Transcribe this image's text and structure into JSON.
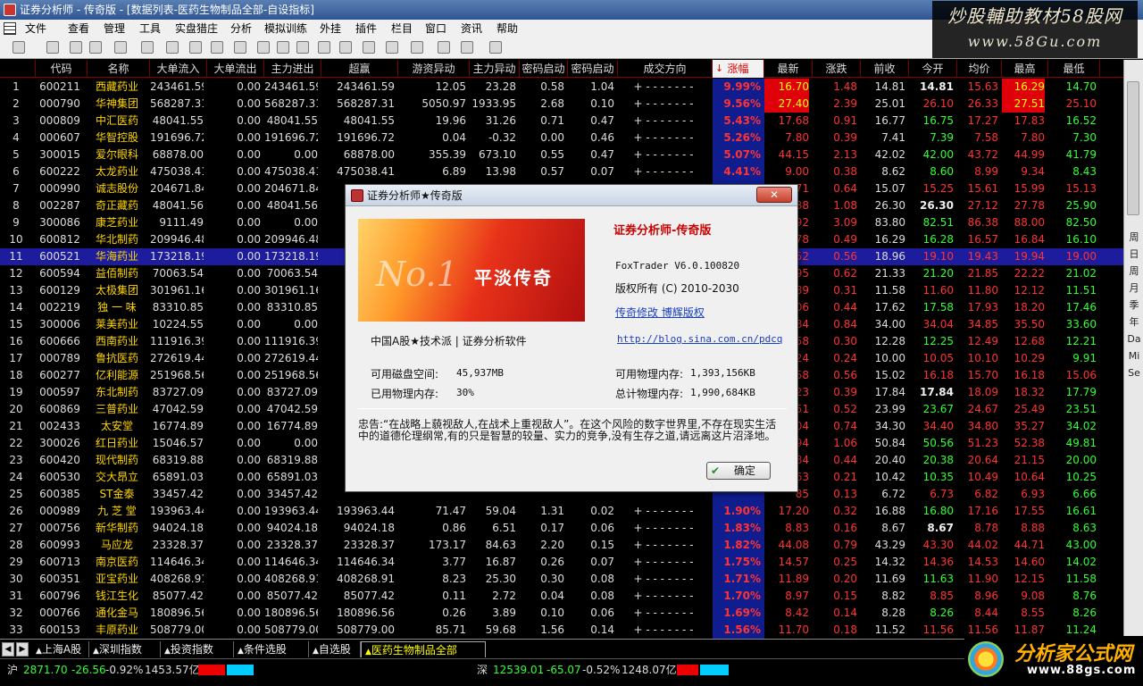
{
  "window": {
    "title": "证券分析师 - 传奇版 - [数据列表-医药生物制品全部-自设指标]"
  },
  "watermark": {
    "line1": "炒股輔助教材58股网",
    "line2": "www.58Gu.com"
  },
  "menu": [
    "文件",
    "查看",
    "管理",
    "工具",
    "实盘猎庄",
    "分析",
    "模拟训练",
    "外挂",
    "插件",
    "栏目",
    "窗口",
    "资讯",
    "帮助"
  ],
  "toolbar": {
    "icons": [
      "open-icon",
      "chart-icon",
      "crosshair-icon",
      "pen-icon",
      "power-icon",
      "compare-icon",
      "layout-icon",
      "stop-icon",
      "color-icon",
      "zoom-icon",
      "home-icon",
      "filter-icon",
      "grid-icon",
      "candle-icon",
      "candle-icon-2",
      "trend-icon",
      "cursor-icon",
      "line-icon",
      "text-icon",
      "eraser-icon",
      "save-icon"
    ]
  },
  "columns": [
    "",
    "代码",
    "名称",
    "大单流入",
    "大单流出",
    "主力进出",
    "超赢",
    "游资异动",
    "主力异动",
    "密码启动",
    "密码启动",
    "成交方向",
    "涨幅",
    "最新",
    "涨跌",
    "前收",
    "今开",
    "均价",
    "最高",
    "最低"
  ],
  "sort_indicator": "↓",
  "rows": [
    {
      "n": "1",
      "code": "600211",
      "name": "西藏药业",
      "in": "243461.59",
      "out": "0.00",
      "net": "243461.59",
      "super": "243461.59",
      "hot": "12.05",
      "main": "23.28",
      "p1": "0.58",
      "p2": "1.04",
      "dir": "+ - - - - - - -",
      "pct": "9.99%",
      "last": "16.70",
      "chg": "1.48",
      "prev": "14.81",
      "open": "14.81",
      "avg": "15.63",
      "high": "16.29",
      "low": "14.70",
      "hl": true
    },
    {
      "n": "2",
      "code": "000790",
      "name": "华神集团",
      "in": "568287.31",
      "out": "0.00",
      "net": "568287.31",
      "super": "568287.31",
      "hot": "5050.97",
      "main": "1933.95",
      "p1": "2.68",
      "p2": "0.10",
      "dir": "+ - - - - - - -",
      "pct": "9.56%",
      "last": "27.40",
      "chg": "2.39",
      "prev": "25.01",
      "open": "26.10",
      "avg": "26.33",
      "high": "27.51",
      "low": "25.10",
      "hl": true
    },
    {
      "n": "3",
      "code": "000809",
      "name": "中汇医药",
      "in": "48041.55",
      "out": "0.00",
      "net": "48041.55",
      "super": "48041.55",
      "hot": "19.96",
      "main": "31.26",
      "p1": "0.71",
      "p2": "0.47",
      "dir": "+ - - - - - - -",
      "pct": "5.43%",
      "last": "17.68",
      "chg": "0.91",
      "prev": "16.77",
      "open": "16.75",
      "avg": "17.27",
      "high": "17.83",
      "low": "16.52"
    },
    {
      "n": "4",
      "code": "000607",
      "name": "华智控股",
      "in": "191696.72",
      "out": "0.00",
      "net": "191696.72",
      "super": "191696.72",
      "hot": "0.04",
      "main": "-0.32",
      "p1": "0.00",
      "p2": "0.46",
      "dir": "+ - - - - - - -",
      "pct": "5.26%",
      "last": "7.80",
      "chg": "0.39",
      "prev": "7.41",
      "open": "7.39",
      "avg": "7.58",
      "high": "7.80",
      "low": "7.30"
    },
    {
      "n": "5",
      "code": "300015",
      "name": "爱尔眼科",
      "in": "68878.00",
      "out": "0.00",
      "net": "0.00",
      "super": "68878.00",
      "hot": "355.39",
      "main": "673.10",
      "p1": "0.55",
      "p2": "0.47",
      "dir": "+ - - - - - - -",
      "pct": "5.07%",
      "last": "44.15",
      "chg": "2.13",
      "prev": "42.02",
      "open": "42.00",
      "avg": "43.72",
      "high": "44.99",
      "low": "41.79"
    },
    {
      "n": "6",
      "code": "600222",
      "name": "太龙药业",
      "in": "475038.41",
      "out": "0.00",
      "net": "475038.41",
      "super": "475038.41",
      "hot": "6.89",
      "main": "13.98",
      "p1": "0.57",
      "p2": "0.07",
      "dir": "+ - - - - - - -",
      "pct": "4.41%",
      "last": "9.00",
      "chg": "0.38",
      "prev": "8.62",
      "open": "8.60",
      "avg": "8.99",
      "high": "9.34",
      "low": "8.43"
    },
    {
      "n": "7",
      "code": "000990",
      "name": "诚志股份",
      "in": "204671.84",
      "out": "0.00",
      "net": "204671.84",
      "super": "",
      "hot": "",
      "main": "",
      "p1": "",
      "p2": "",
      "dir": "",
      "pct": "",
      "last": "71",
      "chg": "0.64",
      "prev": "15.07",
      "open": "15.25",
      "avg": "15.61",
      "high": "15.99",
      "low": "15.13"
    },
    {
      "n": "8",
      "code": "002287",
      "name": "奇正藏药",
      "in": "48041.56",
      "out": "0.00",
      "net": "48041.56",
      "super": "",
      "hot": "",
      "main": "",
      "p1": "",
      "p2": "",
      "dir": "",
      "pct": "",
      "last": "38",
      "chg": "1.08",
      "prev": "26.30",
      "open": "26.30",
      "avg": "27.12",
      "high": "27.78",
      "low": "25.90"
    },
    {
      "n": "9",
      "code": "300086",
      "name": "康芝药业",
      "in": "9111.49",
      "out": "0.00",
      "net": "0.00",
      "super": "",
      "hot": "",
      "main": "",
      "p1": "",
      "p2": "",
      "dir": "",
      "pct": "",
      "last": "92",
      "chg": "3.09",
      "prev": "83.80",
      "open": "82.51",
      "avg": "86.38",
      "high": "88.00",
      "low": "82.50"
    },
    {
      "n": "10",
      "code": "600812",
      "name": "华北制药",
      "in": "209946.48",
      "out": "0.00",
      "net": "209946.48",
      "super": "",
      "hot": "",
      "main": "",
      "p1": "",
      "p2": "",
      "dir": "",
      "pct": "",
      "last": "78",
      "chg": "0.49",
      "prev": "16.29",
      "open": "16.28",
      "avg": "16.57",
      "high": "16.84",
      "low": "16.10"
    },
    {
      "n": "11",
      "code": "600521",
      "name": "华海药业",
      "in": "173218.19",
      "out": "0.00",
      "net": "173218.19",
      "super": "",
      "hot": "",
      "main": "",
      "p1": "",
      "p2": "",
      "dir": "",
      "pct": "",
      "last": "52",
      "chg": "0.56",
      "prev": "18.96",
      "open": "19.10",
      "avg": "19.43",
      "high": "19.94",
      "low": "19.00",
      "sel": true
    },
    {
      "n": "12",
      "code": "600594",
      "name": "益佰制药",
      "in": "70063.54",
      "out": "0.00",
      "net": "70063.54",
      "super": "",
      "hot": "",
      "main": "",
      "p1": "",
      "p2": "",
      "dir": "",
      "pct": "",
      "last": "95",
      "chg": "0.62",
      "prev": "21.33",
      "open": "21.20",
      "avg": "21.85",
      "high": "22.22",
      "low": "21.02"
    },
    {
      "n": "13",
      "code": "600129",
      "name": "太极集团",
      "in": "301961.16",
      "out": "0.00",
      "net": "301961.16",
      "super": "",
      "hot": "",
      "main": "",
      "p1": "",
      "p2": "",
      "dir": "",
      "pct": "",
      "last": "89",
      "chg": "0.31",
      "prev": "11.58",
      "open": "11.60",
      "avg": "11.80",
      "high": "12.12",
      "low": "11.51"
    },
    {
      "n": "14",
      "code": "002219",
      "name": "独 一 味",
      "in": "83310.85",
      "out": "0.00",
      "net": "83310.85",
      "super": "",
      "hot": "",
      "main": "",
      "p1": "",
      "p2": "",
      "dir": "",
      "pct": "",
      "last": "06",
      "chg": "0.44",
      "prev": "17.62",
      "open": "17.58",
      "avg": "17.93",
      "high": "18.20",
      "low": "17.46"
    },
    {
      "n": "15",
      "code": "300006",
      "name": "莱美药业",
      "in": "10224.55",
      "out": "0.00",
      "net": "0.00",
      "super": "",
      "hot": "",
      "main": "",
      "p1": "",
      "p2": "",
      "dir": "",
      "pct": "",
      "last": "84",
      "chg": "0.84",
      "prev": "34.00",
      "open": "34.04",
      "avg": "34.85",
      "high": "35.50",
      "low": "33.60"
    },
    {
      "n": "16",
      "code": "600666",
      "name": "西南药业",
      "in": "111916.39",
      "out": "0.00",
      "net": "111916.39",
      "super": "",
      "hot": "",
      "main": "",
      "p1": "",
      "p2": "",
      "dir": "",
      "pct": "",
      "last": "58",
      "chg": "0.30",
      "prev": "12.28",
      "open": "12.25",
      "avg": "12.49",
      "high": "12.68",
      "low": "12.21"
    },
    {
      "n": "17",
      "code": "000789",
      "name": "鲁抗医药",
      "in": "272619.44",
      "out": "0.00",
      "net": "272619.44",
      "super": "",
      "hot": "",
      "main": "",
      "p1": "",
      "p2": "",
      "dir": "",
      "pct": "",
      "last": "24",
      "chg": "0.24",
      "prev": "10.00",
      "open": "10.05",
      "avg": "10.10",
      "high": "10.29",
      "low": "9.91"
    },
    {
      "n": "18",
      "code": "600277",
      "name": "亿利能源",
      "in": "251968.56",
      "out": "0.00",
      "net": "251968.56",
      "super": "",
      "hot": "",
      "main": "",
      "p1": "",
      "p2": "",
      "dir": "",
      "pct": "",
      "last": "58",
      "chg": "0.56",
      "prev": "15.02",
      "open": "16.18",
      "avg": "15.70",
      "high": "16.18",
      "low": "15.06"
    },
    {
      "n": "19",
      "code": "000597",
      "name": "东北制药",
      "in": "83727.09",
      "out": "0.00",
      "net": "83727.09",
      "super": "",
      "hot": "",
      "main": "",
      "p1": "",
      "p2": "",
      "dir": "",
      "pct": "",
      "last": "23",
      "chg": "0.39",
      "prev": "17.84",
      "open": "17.84",
      "avg": "18.09",
      "high": "18.32",
      "low": "17.79"
    },
    {
      "n": "20",
      "code": "600869",
      "name": "三普药业",
      "in": "47042.59",
      "out": "0.00",
      "net": "47042.59",
      "super": "",
      "hot": "",
      "main": "",
      "p1": "",
      "p2": "",
      "dir": "",
      "pct": "",
      "last": "51",
      "chg": "0.52",
      "prev": "23.99",
      "open": "23.67",
      "avg": "24.67",
      "high": "25.49",
      "low": "23.51"
    },
    {
      "n": "21",
      "code": "002433",
      "name": "太安堂",
      "in": "16774.89",
      "out": "0.00",
      "net": "16774.89",
      "super": "",
      "hot": "",
      "main": "",
      "p1": "",
      "p2": "",
      "dir": "",
      "pct": "",
      "last": "04",
      "chg": "0.74",
      "prev": "34.30",
      "open": "34.40",
      "avg": "34.80",
      "high": "35.27",
      "low": "34.02"
    },
    {
      "n": "22",
      "code": "300026",
      "name": "红日药业",
      "in": "15046.57",
      "out": "0.00",
      "net": "0.00",
      "super": "",
      "hot": "",
      "main": "",
      "p1": "",
      "p2": "",
      "dir": "",
      "pct": "",
      "last": "94",
      "chg": "1.06",
      "prev": "50.84",
      "open": "50.56",
      "avg": "51.23",
      "high": "52.38",
      "low": "49.81"
    },
    {
      "n": "23",
      "code": "600420",
      "name": "现代制药",
      "in": "68319.88",
      "out": "0.00",
      "net": "68319.88",
      "super": "",
      "hot": "",
      "main": "",
      "p1": "",
      "p2": "",
      "dir": "",
      "pct": "",
      "last": "84",
      "chg": "0.44",
      "prev": "20.40",
      "open": "20.38",
      "avg": "20.64",
      "high": "21.15",
      "low": "20.00"
    },
    {
      "n": "24",
      "code": "600530",
      "name": "交大昂立",
      "in": "65891.03",
      "out": "0.00",
      "net": "65891.03",
      "super": "",
      "hot": "",
      "main": "",
      "p1": "",
      "p2": "",
      "dir": "",
      "pct": "",
      "last": "63",
      "chg": "0.21",
      "prev": "10.42",
      "open": "10.35",
      "avg": "10.49",
      "high": "10.64",
      "low": "10.25"
    },
    {
      "n": "25",
      "code": "600385",
      "name": "ST金泰",
      "in": "33457.42",
      "out": "0.00",
      "net": "33457.42",
      "super": "",
      "hot": "",
      "main": "",
      "p1": "",
      "p2": "",
      "dir": "",
      "pct": "",
      "last": "85",
      "chg": "0.13",
      "prev": "6.72",
      "open": "6.73",
      "avg": "6.82",
      "high": "6.93",
      "low": "6.66"
    },
    {
      "n": "26",
      "code": "000989",
      "name": "九 芝 堂",
      "in": "193963.44",
      "out": "0.00",
      "net": "193963.44",
      "super": "193963.44",
      "hot": "71.47",
      "main": "59.04",
      "p1": "1.31",
      "p2": "0.02",
      "dir": "+ - - - - - - -",
      "pct": "1.90%",
      "last": "17.20",
      "chg": "0.32",
      "prev": "16.88",
      "open": "16.80",
      "avg": "17.16",
      "high": "17.55",
      "low": "16.61"
    },
    {
      "n": "27",
      "code": "000756",
      "name": "新华制药",
      "in": "94024.18",
      "out": "0.00",
      "net": "94024.18",
      "super": "94024.18",
      "hot": "0.86",
      "main": "6.51",
      "p1": "0.17",
      "p2": "0.06",
      "dir": "+ - - - - - - -",
      "pct": "1.83%",
      "last": "8.83",
      "chg": "0.16",
      "prev": "8.67",
      "open": "8.67",
      "avg": "8.78",
      "high": "8.88",
      "low": "8.63"
    },
    {
      "n": "28",
      "code": "600993",
      "name": "马应龙",
      "in": "23328.37",
      "out": "0.00",
      "net": "23328.37",
      "super": "23328.37",
      "hot": "173.17",
      "main": "84.63",
      "p1": "2.20",
      "p2": "0.15",
      "dir": "+ - - - - - - -",
      "pct": "1.82%",
      "last": "44.08",
      "chg": "0.79",
      "prev": "43.29",
      "open": "43.30",
      "avg": "44.02",
      "high": "44.71",
      "low": "43.00"
    },
    {
      "n": "29",
      "code": "600713",
      "name": "南京医药",
      "in": "114646.34",
      "out": "0.00",
      "net": "114646.34",
      "super": "114646.34",
      "hot": "3.77",
      "main": "16.87",
      "p1": "0.26",
      "p2": "0.07",
      "dir": "+ - - - - - - -",
      "pct": "1.75%",
      "last": "14.57",
      "chg": "0.25",
      "prev": "14.32",
      "open": "14.36",
      "avg": "14.53",
      "high": "14.60",
      "low": "14.02"
    },
    {
      "n": "30",
      "code": "600351",
      "name": "亚宝药业",
      "in": "408268.91",
      "out": "0.00",
      "net": "408268.91",
      "super": "408268.91",
      "hot": "8.23",
      "main": "25.30",
      "p1": "0.30",
      "p2": "0.08",
      "dir": "+ - - - - - - -",
      "pct": "1.71%",
      "last": "11.89",
      "chg": "0.20",
      "prev": "11.69",
      "open": "11.63",
      "avg": "11.90",
      "high": "12.15",
      "low": "11.58"
    },
    {
      "n": "31",
      "code": "600796",
      "name": "钱江生化",
      "in": "85077.42",
      "out": "0.00",
      "net": "85077.42",
      "super": "85077.42",
      "hot": "0.11",
      "main": "2.72",
      "p1": "0.04",
      "p2": "0.08",
      "dir": "+ - - - - - - -",
      "pct": "1.70%",
      "last": "8.97",
      "chg": "0.15",
      "prev": "8.82",
      "open": "8.85",
      "avg": "8.96",
      "high": "9.08",
      "low": "8.76"
    },
    {
      "n": "32",
      "code": "000766",
      "name": "通化金马",
      "in": "180896.56",
      "out": "0.00",
      "net": "180896.56",
      "super": "180896.56",
      "hot": "0.26",
      "main": "3.89",
      "p1": "0.10",
      "p2": "0.06",
      "dir": "+ - - - - - - -",
      "pct": "1.69%",
      "last": "8.42",
      "chg": "0.14",
      "prev": "8.28",
      "open": "8.26",
      "avg": "8.44",
      "high": "8.55",
      "low": "8.26"
    },
    {
      "n": "33",
      "code": "600153",
      "name": "丰原药业",
      "in": "508779.00",
      "out": "0.00",
      "net": "508779.00",
      "super": "508779.00",
      "hot": "85.71",
      "main": "59.68",
      "p1": "1.56",
      "p2": "0.14",
      "dir": "+ - - - - - - -",
      "pct": "1.56%",
      "last": "11.70",
      "chg": "0.18",
      "prev": "11.52",
      "open": "11.56",
      "avg": "11.56",
      "high": "11.87",
      "low": "11.24"
    }
  ],
  "sidebar": [
    "周",
    "日",
    "周",
    "月",
    "季",
    "年",
    "Da",
    "Mi",
    "Se"
  ],
  "tabs": [
    "上海A股",
    "深圳指数",
    "投资指数",
    "条件选股",
    "自选股",
    "医药生物制品全部"
  ],
  "status": {
    "sh_label": "沪",
    "sh_index": "2871.70",
    "sh_chg": "-26.56",
    "sh_pct": "-0.92%",
    "sh_amount": "1453.57亿",
    "sz_label": "深",
    "sz_index": "12539.01",
    "sz_chg": "-65.07",
    "sz_pct": "-0.52%",
    "sz_amount": "1248.07亿"
  },
  "logo": {
    "main": "分析家公式网",
    "sub": "www.88gs.com"
  },
  "dialog": {
    "title": "证券分析师★传奇版",
    "close": "✕",
    "banner_no1": "No.1",
    "banner_text": "平淡传奇",
    "heading": "证券分析师-传奇版",
    "version": "FoxTrader V6.0.100820",
    "copyright": "版权所有 (C) 2010-2030",
    "modifier": "传奇修改 博辉版权",
    "url": "http://blog.sina.com.cn/pdcq",
    "slogan": "中国A股★技术派 | 证券分析软件",
    "disk_label": "可用磁盘空间:",
    "disk_value": "45,937MB",
    "mem_avail_label": "可用物理内存:",
    "mem_avail_value": "1,393,156KB",
    "mem_used_label": "已用物理内存:",
    "mem_used_value": "30%",
    "mem_total_label": "总计物理内存:",
    "mem_total_value": "1,990,684KB",
    "warning": "忠告:“在战略上藐视敌人,在战术上重视敌人”。在这个风险的数字世界里,不存在现实生活中的道德伦理纲常,有的只是智慧的较量、实力的竞争,没有生存之道,请远离这片沼泽地。",
    "ok": "确定"
  }
}
